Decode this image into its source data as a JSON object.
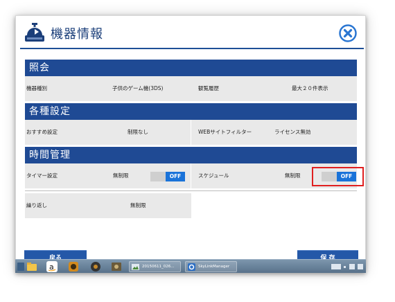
{
  "window": {
    "title": "機器情報"
  },
  "sections": {
    "inquiry": {
      "header": "照会",
      "device_type_label": "機器種別",
      "device_type_value": "子供のゲーム機(3DS)",
      "history_label": "観覧履歴",
      "history_value": "最大２０件表示"
    },
    "settings": {
      "header": "各種設定",
      "recommended_label": "おすすめ設定",
      "recommended_value": "制限なし",
      "web_filter_label": "WEBサイトフィルター",
      "web_filter_value": "ライセンス無効"
    },
    "time": {
      "header": "時間管理",
      "timer_label": "タイマー設定",
      "timer_value": "無制限",
      "timer_toggle": "OFF",
      "schedule_label": "スケジュール",
      "schedule_value": "無制限",
      "schedule_toggle": "OFF",
      "repeat_label": "繰り返し",
      "repeat_value": "無制限"
    }
  },
  "buttons": {
    "back": "戻る",
    "save": "保 存"
  },
  "taskbar": {
    "tasks": [
      {
        "label": "20150611_026...",
        "icon": "image-viewer-icon"
      },
      {
        "label": "SkyLinkManager",
        "icon": "gear-app-icon"
      }
    ],
    "pinned_icons": [
      "folder-icon",
      "amazon-icon",
      "camera-icon",
      "record-icon",
      "photo-icon"
    ]
  },
  "colors": {
    "accent": "#1f4a94",
    "toggle_on": "#1a73d9",
    "highlight": "#e01f1f"
  }
}
